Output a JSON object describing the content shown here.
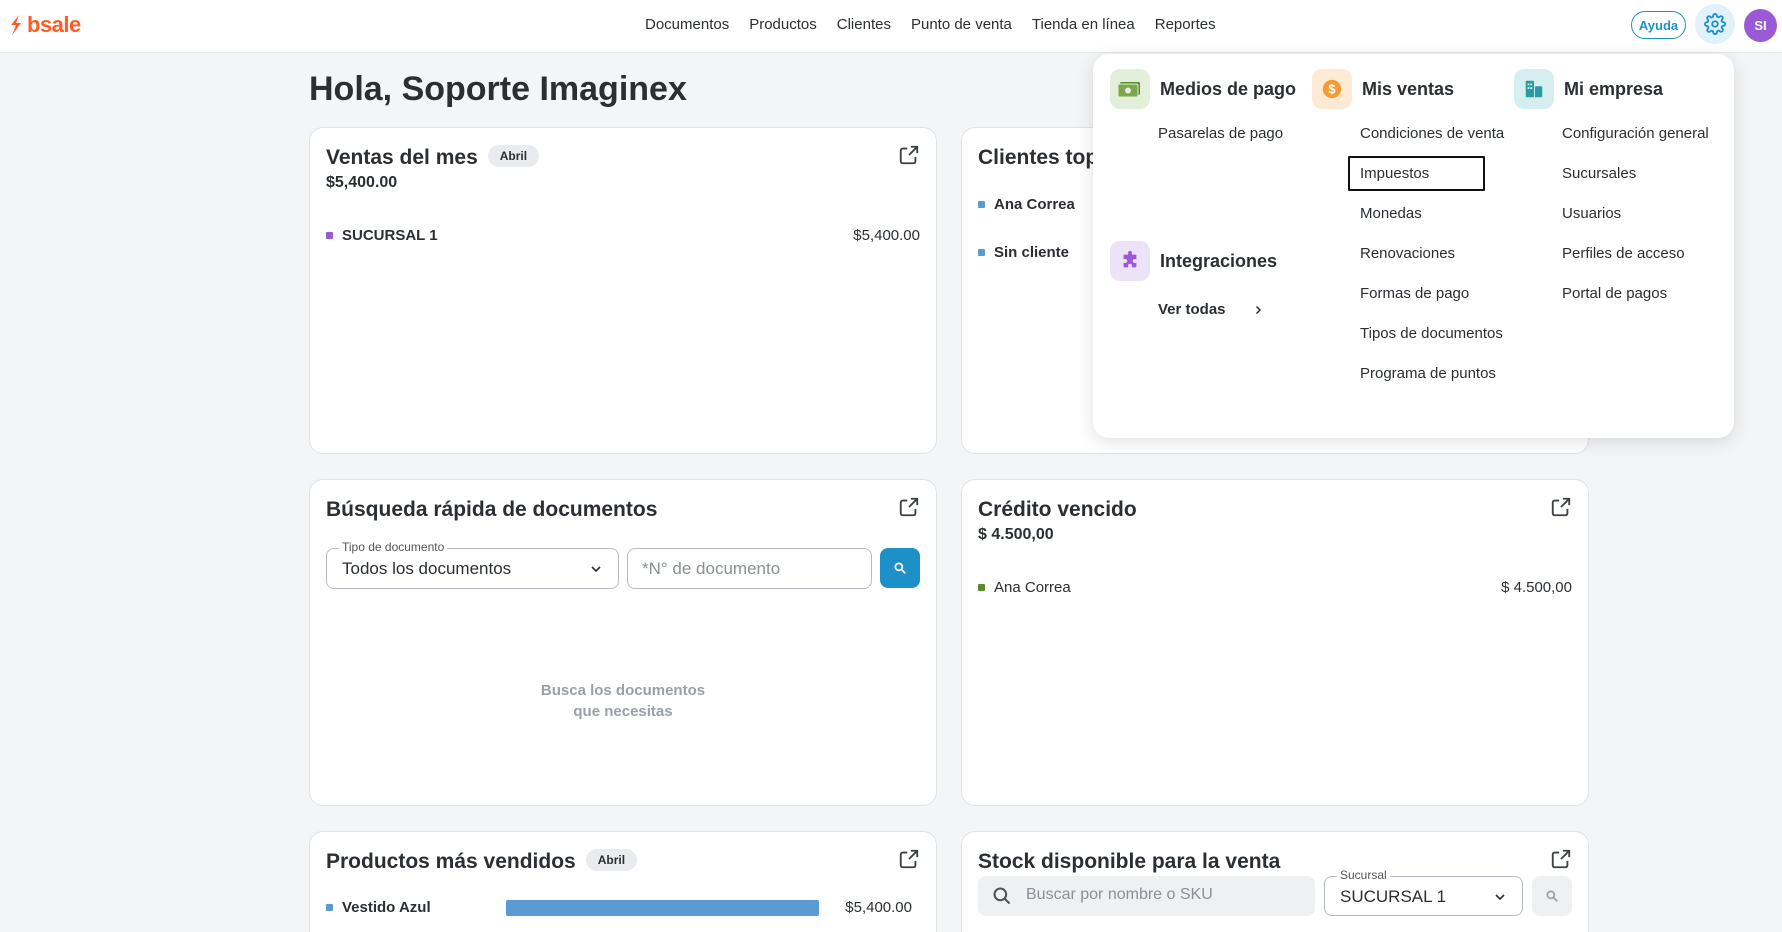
{
  "app": {
    "logo_text": "bsale",
    "brand_color": "#ff5b22",
    "accent_color": "#1e90c8"
  },
  "nav": {
    "items": [
      "Documentos",
      "Productos",
      "Clientes",
      "Punto de venta",
      "Tienda en línea",
      "Reportes"
    ]
  },
  "header": {
    "help_label": "Ayuda",
    "avatar_initials": "SI"
  },
  "greeting": "Hola, Soporte Imaginex",
  "ventas": {
    "title": "Ventas del mes",
    "badge": "Abril",
    "amount": "$5,400.00",
    "rows": [
      {
        "label": "SUCURSAL 1",
        "value": "$5,400.00",
        "color": "#9b59d8"
      }
    ]
  },
  "clientes": {
    "title": "Clientes top",
    "rows": [
      {
        "label": "Ana Correa",
        "color": "#5b9bd5"
      },
      {
        "label": "Sin cliente",
        "color": "#5b9bd5"
      }
    ]
  },
  "busqueda": {
    "title": "Búsqueda rápida de documentos",
    "tipo_legend": "Tipo de documento",
    "tipo_value": "Todos los documentos",
    "numero_placeholder": "*N° de documento",
    "empty_line1": "Busca los documentos",
    "empty_line2": "que necesitas"
  },
  "credito": {
    "title": "Crédito vencido",
    "amount": "$ 4.500,00",
    "rows": [
      {
        "label": "Ana Correa",
        "value": "$ 4.500,00",
        "color": "#5a8a2e"
      }
    ]
  },
  "productos": {
    "title": "Productos más vendidos",
    "badge": "Abril",
    "rows": [
      {
        "label": "Vestido Azul",
        "value": "$5,400.00",
        "share": 1.0,
        "color": "#5b9bd5"
      }
    ]
  },
  "stock": {
    "title": "Stock disponible para la venta",
    "search_placeholder": "Buscar por nombre o SKU",
    "sucursal_legend": "Sucursal",
    "sucursal_value": "SUCURSAL 1"
  },
  "settings_menu": {
    "medios": {
      "title": "Medios de pago",
      "items": [
        "Pasarelas de pago"
      ]
    },
    "integraciones": {
      "title": "Integraciones",
      "link": "Ver todas"
    },
    "ventas": {
      "title": "Mis ventas",
      "items": [
        "Condiciones de venta",
        "Impuestos",
        "Monedas",
        "Renovaciones",
        "Formas de pago",
        "Tipos de documentos",
        "Programa de puntos"
      ],
      "active": "Impuestos"
    },
    "empresa": {
      "title": "Mi empresa",
      "items": [
        "Configuración general",
        "Sucursales",
        "Usuarios",
        "Perfiles de acceso",
        "Portal de pagos"
      ]
    }
  }
}
